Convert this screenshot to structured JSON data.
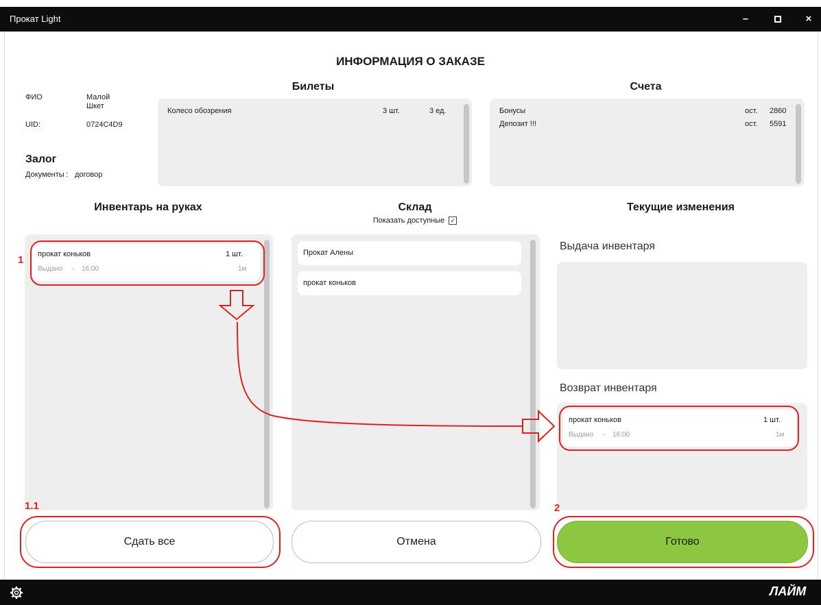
{
  "window": {
    "title": "Прокат Light",
    "minimize": "–",
    "maximize": "▫",
    "close": "×"
  },
  "page_title": "ИНФОРМАЦИЯ О ЗАКАЗЕ",
  "client": {
    "fio_label": "ФИО",
    "fio_value_1": "Малой",
    "fio_value_2": "Шкет",
    "uid_label": "UID:",
    "uid_value": "0724C4D9"
  },
  "deposit": {
    "title": "Залог",
    "documents_label": "Документы",
    "separator": ":",
    "documents_value": "договор"
  },
  "tickets": {
    "title": "Билеты",
    "items": [
      {
        "name": "Колесо обозрения",
        "qty": "3 шт.",
        "units": "3 ед."
      }
    ]
  },
  "accounts": {
    "title": "Счета",
    "items": [
      {
        "name": "Бонусы",
        "prefix": "ост.",
        "value": "2860"
      },
      {
        "name": "Депозит !!!",
        "prefix": "ост.",
        "value": "5591"
      }
    ]
  },
  "inventory_on_hand": {
    "title": "Инвентарь на руках",
    "items": [
      {
        "name": "прокат коньков",
        "qty": "1 шт.",
        "status": "Выдано",
        "dash": "-",
        "time": "16:00",
        "duration": "1м"
      }
    ]
  },
  "warehouse": {
    "title": "Склад",
    "show_available_label": "Показать доступные",
    "show_available_checked": "✓",
    "items": [
      {
        "name": "Прокат Алены"
      },
      {
        "name": "прокат коньков"
      }
    ]
  },
  "current_changes": {
    "title": "Текущие изменения",
    "issue_title": "Выдача инвентаря",
    "return_title": "Возврат инвентаря",
    "return_items": [
      {
        "name": "прокат коньков",
        "qty": "1 шт.",
        "status": "Выдано",
        "dash": "-",
        "time": "16:00",
        "duration": "1м"
      }
    ]
  },
  "buttons": {
    "return_all": "Сдать все",
    "cancel": "Отмена",
    "done": "Готово"
  },
  "annotations": {
    "step1": "1",
    "step1_1": "1.1",
    "step2": "2"
  },
  "brand": {
    "logo": "ЛАЙМ",
    "accent_color": "#8dc640",
    "annotation_color": "#e02020"
  }
}
